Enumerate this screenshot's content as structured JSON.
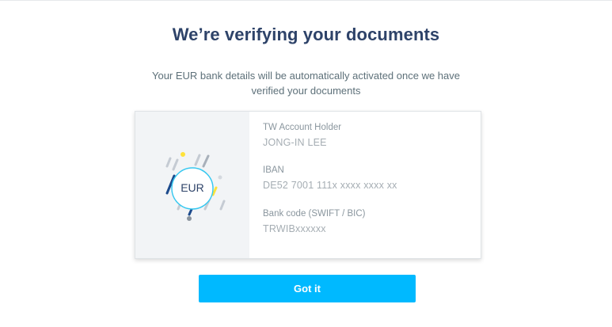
{
  "header": {
    "title": "We’re verifying your documents",
    "subtitle": "Your EUR bank details will be automatically activated once we have verified your documents"
  },
  "card": {
    "currency_code": "EUR",
    "currency_icon": "eur-currency-icon",
    "fields": [
      {
        "label": "TW Account Holder",
        "value": "JONG-IN LEE"
      },
      {
        "label": "IBAN",
        "value": "DE52 7001 111x xxxx xxxx xx"
      },
      {
        "label": "Bank code (SWIFT / BIC)",
        "value": "TRWIBxxxxxx"
      }
    ]
  },
  "actions": {
    "confirm_label": "Got it"
  },
  "colors": {
    "title": "#2e4369",
    "accent": "#00b9ff",
    "ring": "#37c8f0",
    "dark_blue": "#1c4a8c",
    "yellow": "#ffe23a"
  }
}
